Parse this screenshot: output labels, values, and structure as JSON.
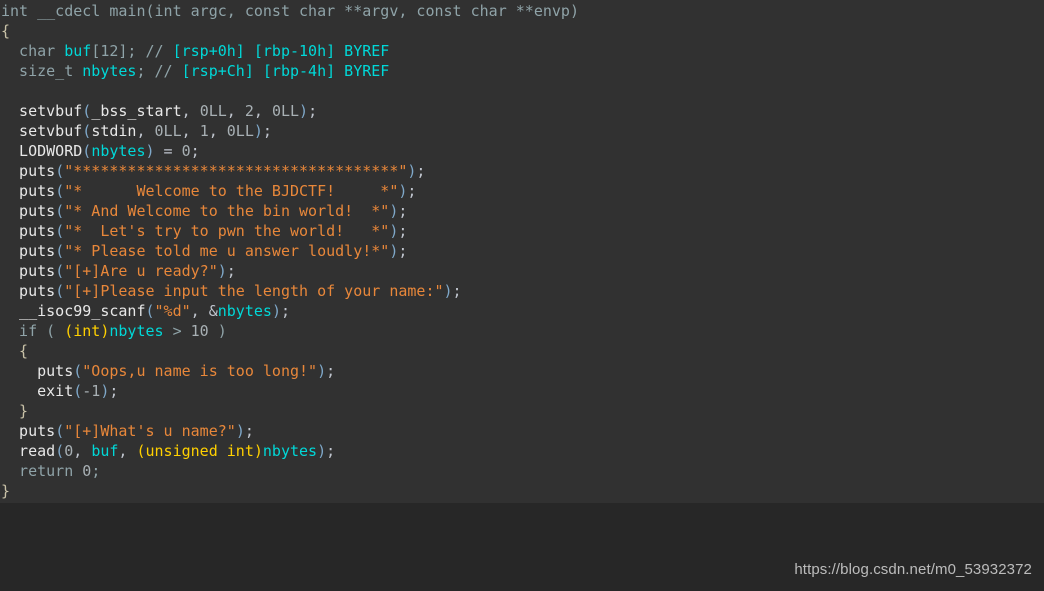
{
  "window": {
    "title": "IDA Pseudocode",
    "background_color": "#272727",
    "code_background_color": "#313131"
  },
  "watermark": {
    "text": "https://blog.csdn.net/m0_53932372"
  },
  "palette": {
    "keyword": "#8fa3a8",
    "function": "#e8e8e8",
    "variable": "#00d8d8",
    "string": "#e8873a",
    "cast": "#ffd000",
    "comment": "#00d8d8",
    "number": "#a8b0b4",
    "brace": "#c9c2a8",
    "paren": "#7fa8c9"
  },
  "code": {
    "language": "c-pseudocode",
    "lines": [
      {
        "id": 0,
        "tokens": [
          {
            "t": "keyword",
            "v": "int __cdecl main(int argc, const char **argv, const char **envp)"
          }
        ]
      },
      {
        "id": 1,
        "tokens": [
          {
            "t": "brace",
            "v": "{"
          }
        ]
      },
      {
        "id": 2,
        "tokens": [
          {
            "t": "keyword",
            "v": "  char "
          },
          {
            "t": "var",
            "v": "buf"
          },
          {
            "t": "keyword",
            "v": "[12]; "
          },
          {
            "t": "cmtmark",
            "v": "// "
          },
          {
            "t": "comment",
            "v": "[rsp+0h] [rbp-10h] BYREF"
          }
        ]
      },
      {
        "id": 3,
        "tokens": [
          {
            "t": "keyword",
            "v": "  size_t "
          },
          {
            "t": "var",
            "v": "nbytes"
          },
          {
            "t": "keyword",
            "v": "; "
          },
          {
            "t": "cmtmark",
            "v": "// "
          },
          {
            "t": "comment",
            "v": "[rsp+Ch] [rbp-4h] BYREF"
          }
        ]
      },
      {
        "id": 4,
        "tokens": [
          {
            "t": "default",
            "v": ""
          }
        ]
      },
      {
        "id": 5,
        "tokens": [
          {
            "t": "func",
            "v": "  setvbuf"
          },
          {
            "t": "paren",
            "v": "("
          },
          {
            "t": "func",
            "v": "_bss_start"
          },
          {
            "t": "default",
            "v": ", "
          },
          {
            "t": "number",
            "v": "0LL"
          },
          {
            "t": "default",
            "v": ", "
          },
          {
            "t": "number",
            "v": "2"
          },
          {
            "t": "default",
            "v": ", "
          },
          {
            "t": "number",
            "v": "0LL"
          },
          {
            "t": "paren",
            "v": ")"
          },
          {
            "t": "default",
            "v": ";"
          }
        ]
      },
      {
        "id": 6,
        "tokens": [
          {
            "t": "func",
            "v": "  setvbuf"
          },
          {
            "t": "paren",
            "v": "("
          },
          {
            "t": "func",
            "v": "stdin"
          },
          {
            "t": "default",
            "v": ", "
          },
          {
            "t": "number",
            "v": "0LL"
          },
          {
            "t": "default",
            "v": ", "
          },
          {
            "t": "number",
            "v": "1"
          },
          {
            "t": "default",
            "v": ", "
          },
          {
            "t": "number",
            "v": "0LL"
          },
          {
            "t": "paren",
            "v": ")"
          },
          {
            "t": "default",
            "v": ";"
          }
        ]
      },
      {
        "id": 7,
        "tokens": [
          {
            "t": "macro",
            "v": "  LODWORD"
          },
          {
            "t": "paren",
            "v": "("
          },
          {
            "t": "var",
            "v": "nbytes"
          },
          {
            "t": "paren",
            "v": ")"
          },
          {
            "t": "default",
            "v": " = "
          },
          {
            "t": "number",
            "v": "0"
          },
          {
            "t": "default",
            "v": ";"
          }
        ]
      },
      {
        "id": 8,
        "tokens": [
          {
            "t": "func",
            "v": "  puts"
          },
          {
            "t": "paren",
            "v": "("
          },
          {
            "t": "string",
            "v": "\"************************************\""
          },
          {
            "t": "paren",
            "v": ")"
          },
          {
            "t": "default",
            "v": ";"
          }
        ]
      },
      {
        "id": 9,
        "tokens": [
          {
            "t": "func",
            "v": "  puts"
          },
          {
            "t": "paren",
            "v": "("
          },
          {
            "t": "string",
            "v": "\"*      Welcome to the BJDCTF!     *\""
          },
          {
            "t": "paren",
            "v": ")"
          },
          {
            "t": "default",
            "v": ";"
          }
        ]
      },
      {
        "id": 10,
        "tokens": [
          {
            "t": "func",
            "v": "  puts"
          },
          {
            "t": "paren",
            "v": "("
          },
          {
            "t": "string",
            "v": "\"* And Welcome to the bin world!  *\""
          },
          {
            "t": "paren",
            "v": ")"
          },
          {
            "t": "default",
            "v": ";"
          }
        ]
      },
      {
        "id": 11,
        "tokens": [
          {
            "t": "func",
            "v": "  puts"
          },
          {
            "t": "paren",
            "v": "("
          },
          {
            "t": "string",
            "v": "\"*  Let's try to pwn the world!   *\""
          },
          {
            "t": "paren",
            "v": ")"
          },
          {
            "t": "default",
            "v": ";"
          }
        ]
      },
      {
        "id": 12,
        "tokens": [
          {
            "t": "func",
            "v": "  puts"
          },
          {
            "t": "paren",
            "v": "("
          },
          {
            "t": "string",
            "v": "\"* Please told me u answer loudly!*\""
          },
          {
            "t": "paren",
            "v": ")"
          },
          {
            "t": "default",
            "v": ";"
          }
        ]
      },
      {
        "id": 13,
        "tokens": [
          {
            "t": "func",
            "v": "  puts"
          },
          {
            "t": "paren",
            "v": "("
          },
          {
            "t": "string",
            "v": "\"[+]Are u ready?\""
          },
          {
            "t": "paren",
            "v": ")"
          },
          {
            "t": "default",
            "v": ";"
          }
        ]
      },
      {
        "id": 14,
        "tokens": [
          {
            "t": "func",
            "v": "  puts"
          },
          {
            "t": "paren",
            "v": "("
          },
          {
            "t": "string",
            "v": "\"[+]Please input the length of your name:\""
          },
          {
            "t": "paren",
            "v": ")"
          },
          {
            "t": "default",
            "v": ";"
          }
        ]
      },
      {
        "id": 15,
        "tokens": [
          {
            "t": "func",
            "v": "  __isoc99_scanf"
          },
          {
            "t": "paren",
            "v": "("
          },
          {
            "t": "string",
            "v": "\"%d\""
          },
          {
            "t": "default",
            "v": ", &"
          },
          {
            "t": "var",
            "v": "nbytes"
          },
          {
            "t": "paren",
            "v": ")"
          },
          {
            "t": "default",
            "v": ";"
          }
        ]
      },
      {
        "id": 16,
        "tokens": [
          {
            "t": "keyword",
            "v": "  if ( "
          },
          {
            "t": "cast",
            "v": "(int)"
          },
          {
            "t": "var",
            "v": "nbytes"
          },
          {
            "t": "keyword",
            "v": " > "
          },
          {
            "t": "number",
            "v": "10"
          },
          {
            "t": "keyword",
            "v": " )"
          }
        ]
      },
      {
        "id": 17,
        "tokens": [
          {
            "t": "brace",
            "v": "  {"
          }
        ]
      },
      {
        "id": 18,
        "tokens": [
          {
            "t": "func",
            "v": "    puts"
          },
          {
            "t": "paren",
            "v": "("
          },
          {
            "t": "string",
            "v": "\"Oops,u name is too long!\""
          },
          {
            "t": "paren",
            "v": ")"
          },
          {
            "t": "default",
            "v": ";"
          }
        ]
      },
      {
        "id": 19,
        "tokens": [
          {
            "t": "func",
            "v": "    exit"
          },
          {
            "t": "paren",
            "v": "("
          },
          {
            "t": "number",
            "v": "-1"
          },
          {
            "t": "paren",
            "v": ")"
          },
          {
            "t": "default",
            "v": ";"
          }
        ]
      },
      {
        "id": 20,
        "tokens": [
          {
            "t": "brace",
            "v": "  }"
          }
        ]
      },
      {
        "id": 21,
        "tokens": [
          {
            "t": "func",
            "v": "  puts"
          },
          {
            "t": "paren",
            "v": "("
          },
          {
            "t": "string",
            "v": "\"[+]What's u name?\""
          },
          {
            "t": "paren",
            "v": ")"
          },
          {
            "t": "default",
            "v": ";"
          }
        ]
      },
      {
        "id": 22,
        "tokens": [
          {
            "t": "func",
            "v": "  read"
          },
          {
            "t": "paren",
            "v": "("
          },
          {
            "t": "number",
            "v": "0"
          },
          {
            "t": "default",
            "v": ", "
          },
          {
            "t": "var",
            "v": "buf"
          },
          {
            "t": "default",
            "v": ", "
          },
          {
            "t": "cast",
            "v": "(unsigned int)"
          },
          {
            "t": "var",
            "v": "nbytes"
          },
          {
            "t": "paren",
            "v": ")"
          },
          {
            "t": "default",
            "v": ";"
          }
        ]
      },
      {
        "id": 23,
        "tokens": [
          {
            "t": "keyword",
            "v": "  return "
          },
          {
            "t": "number",
            "v": "0"
          },
          {
            "t": "keyword",
            "v": ";"
          }
        ]
      },
      {
        "id": 24,
        "tokens": [
          {
            "t": "brace",
            "v": "}"
          }
        ]
      }
    ]
  }
}
